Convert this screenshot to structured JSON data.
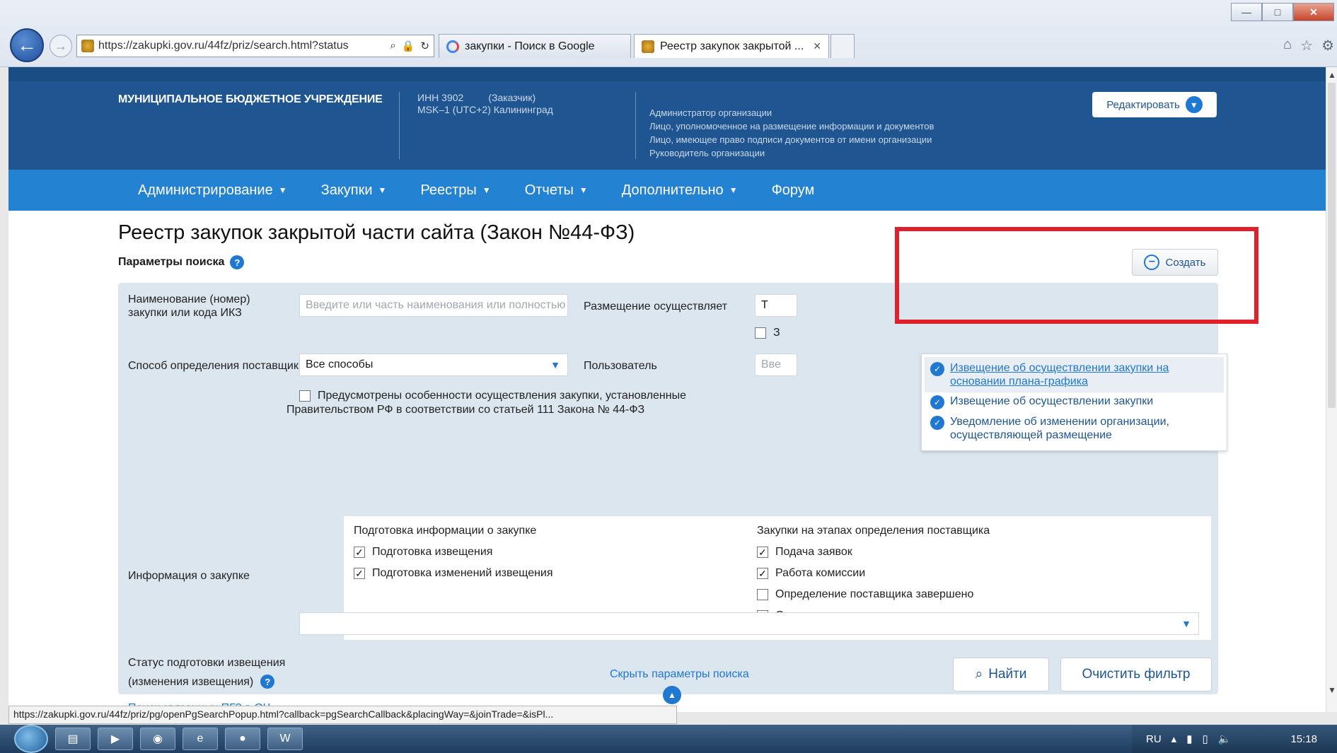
{
  "browser": {
    "url": "https://zakupki.gov.ru/44fz/priz/search.html?status",
    "tabs": [
      {
        "label": "закупки - Поиск в Google",
        "active": false
      },
      {
        "label": "Реестр закупок закрытой ...",
        "active": true
      }
    ],
    "status_url": "https://zakupki.gov.ru/44fz/priz/pg/openPgSearchPopup.html?callback=pgSearchCallback&placingWay=&joinTrade=&isPl..."
  },
  "org": {
    "name": "МУНИЦИПАЛЬНОЕ БЮДЖЕТНОЕ УЧРЕЖДЕНИЕ",
    "inn": "ИНН 3902",
    "role_tag": "(Заказчик)",
    "msk": "MSK–1 (UTC+2) Калининград",
    "roles": [
      "Администратор организации",
      "Лицо, уполномоченное на размещение информации и документов",
      "Лицо, имеющее право подписи документов от имени организации",
      "Руководитель организации"
    ],
    "edit_label": "Редактировать"
  },
  "nav": {
    "items": [
      {
        "label": "Администрирование",
        "caret": true
      },
      {
        "label": "Закупки",
        "caret": true
      },
      {
        "label": "Реестры",
        "caret": true
      },
      {
        "label": "Отчеты",
        "caret": true
      },
      {
        "label": "Дополнительно",
        "caret": true
      },
      {
        "label": "Форум",
        "caret": false
      }
    ]
  },
  "page": {
    "title": "Реестр закупок закрытой части сайта (Закон №44-ФЗ)",
    "params_label": "Параметры поиска",
    "create_label": "Создать"
  },
  "search": {
    "name_label": "Наименование (номер) закупки или кода ИКЗ",
    "name_placeholder": "Введите или часть наименования или полностью но",
    "placement_label": "Размещение осуществляет",
    "placement_value": "Т",
    "placement_check_letter": "З",
    "method_label": "Способ определения поставщика",
    "method_value": "Все способы",
    "user_label": "Пользователь",
    "user_placeholder": "Вве",
    "special_check_label": "Предусмотрены особенности осуществления закупки, установленные",
    "special_check_label2": "Правительством РФ в соответствии со статьей 111 Закона № 44-ФЗ",
    "info_label": "Информация о закупке",
    "prep_head": "Подготовка информации о закупке",
    "prep_items": [
      {
        "label": "Подготовка извещения",
        "checked": true
      },
      {
        "label": "Подготовка изменений извещения",
        "checked": true
      }
    ],
    "stage_head": "Закупки на этапах определения поставщика",
    "stage_items": [
      {
        "label": "Подача заявок",
        "checked": true
      },
      {
        "label": "Работа комиссии",
        "checked": true
      },
      {
        "label": "Определение поставщика завершено",
        "checked": false
      },
      {
        "label": "Определение поставщика отменено",
        "checked": false
      }
    ],
    "status_label_1": "Статус подготовки извещения",
    "status_label_2": "(изменения извещения)",
    "related_link": "Поиск связанных ПГЗ в ОЧ",
    "find_label": "Найти",
    "clear_label": "Очистить фильтр",
    "hide_label": "Скрыть параметры поиска"
  },
  "dropdown": {
    "items": [
      {
        "line1": "Извещение об осуществлении закупки на",
        "line2": "основании плана-графика"
      },
      {
        "line1": "Извещение об осуществлении закупки",
        "line2": ""
      },
      {
        "line1": "Уведомление об изменении организации,",
        "line2": "осуществляющей размещение"
      }
    ]
  },
  "taskbar": {
    "lang": "RU",
    "clock": "15:18"
  },
  "colors": {
    "header_bg": "#1f5591",
    "nav_bg": "#2383d2",
    "accent": "#1f78d1",
    "highlight": "#e0202a",
    "panel_bg": "#dce6ef"
  }
}
